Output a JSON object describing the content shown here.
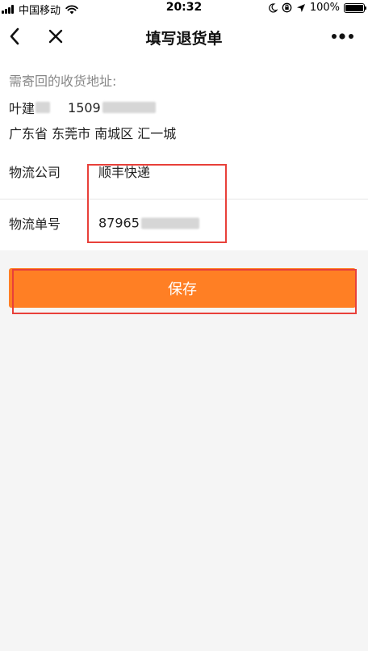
{
  "status_bar": {
    "carrier": "中国移动",
    "time": "20:32",
    "battery": "100%"
  },
  "nav": {
    "title": "填写退货单"
  },
  "address": {
    "label": "需寄回的收货地址:",
    "name": "叶建",
    "phone": "1509",
    "region": "广东省 东莞市 南城区 汇一城"
  },
  "logistics": {
    "company_label": "物流公司",
    "company_value": "顺丰快递",
    "tracking_label": "物流单号",
    "tracking_value": "87965"
  },
  "actions": {
    "save_label": "保存"
  },
  "colors": {
    "accent": "#ff7f24",
    "highlight": "#e8403a",
    "background": "#f5f5f5"
  },
  "icons": {
    "back": "chevron-left-icon",
    "close": "close-icon",
    "more": "more-dots-icon",
    "wifi": "wifi-icon",
    "signal": "signal-icon",
    "moon": "moon-icon",
    "rotation_lock": "rotation-lock-icon",
    "location": "location-arrow-icon",
    "battery": "battery-icon"
  }
}
